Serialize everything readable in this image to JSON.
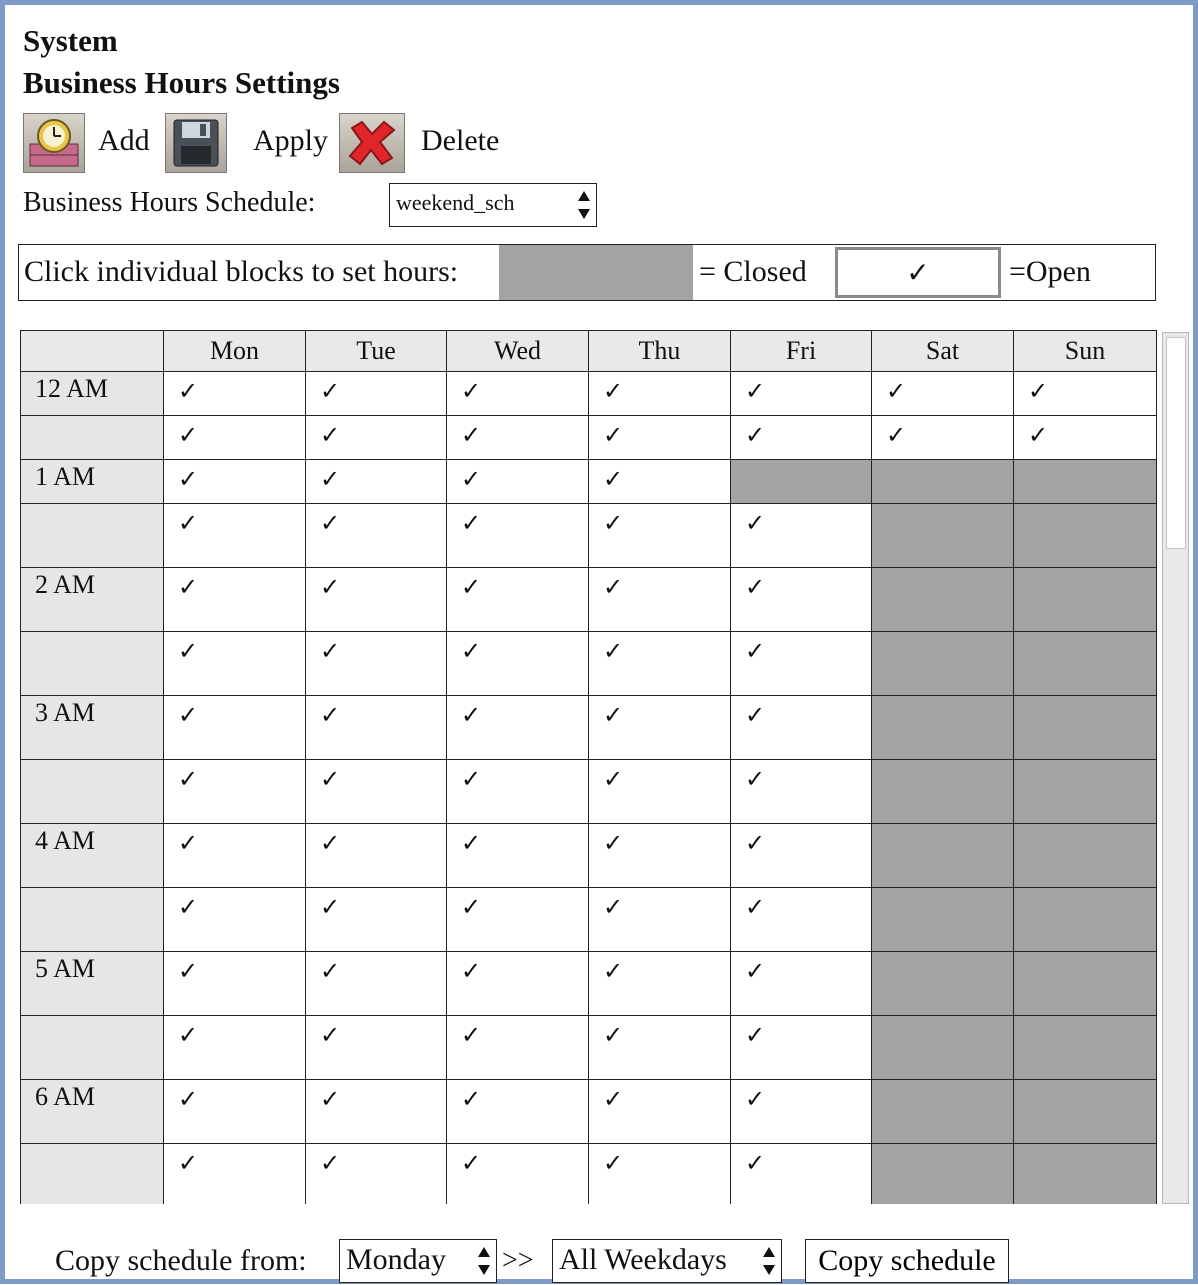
{
  "breadcrumb": "System",
  "page_title": "Business Hours Settings",
  "toolbar": {
    "add_label": "Add",
    "apply_label": "Apply",
    "delete_label": "Delete"
  },
  "schedule": {
    "label": "Business Hours Schedule:",
    "selected": "weekend_sch"
  },
  "legend": {
    "instruction": "Click individual blocks to set hours:",
    "closed_text": "= Closed",
    "open_mark": "✓",
    "open_text": "=Open"
  },
  "grid": {
    "check_mark": "✓",
    "days": [
      "Mon",
      "Tue",
      "Wed",
      "Thu",
      "Fri",
      "Sat",
      "Sun"
    ],
    "rows": [
      {
        "time": "12 AM",
        "open": [
          true,
          true,
          true,
          true,
          true,
          true,
          true
        ]
      },
      {
        "time": "",
        "open": [
          true,
          true,
          true,
          true,
          true,
          true,
          true
        ]
      },
      {
        "time": "1 AM",
        "open": [
          true,
          true,
          true,
          true,
          false,
          false,
          false
        ]
      },
      {
        "time": "",
        "open": [
          true,
          true,
          true,
          true,
          true,
          false,
          false
        ]
      },
      {
        "time": "2 AM",
        "open": [
          true,
          true,
          true,
          true,
          true,
          false,
          false
        ]
      },
      {
        "time": "",
        "open": [
          true,
          true,
          true,
          true,
          true,
          false,
          false
        ]
      },
      {
        "time": "3 AM",
        "open": [
          true,
          true,
          true,
          true,
          true,
          false,
          false
        ]
      },
      {
        "time": "",
        "open": [
          true,
          true,
          true,
          true,
          true,
          false,
          false
        ]
      },
      {
        "time": "4 AM",
        "open": [
          true,
          true,
          true,
          true,
          true,
          false,
          false
        ]
      },
      {
        "time": "",
        "open": [
          true,
          true,
          true,
          true,
          true,
          false,
          false
        ]
      },
      {
        "time": "5 AM",
        "open": [
          true,
          true,
          true,
          true,
          true,
          false,
          false
        ]
      },
      {
        "time": "",
        "open": [
          true,
          true,
          true,
          true,
          true,
          false,
          false
        ]
      },
      {
        "time": "6 AM",
        "open": [
          true,
          true,
          true,
          true,
          true,
          false,
          false
        ]
      },
      {
        "time": "",
        "open": [
          true,
          true,
          true,
          true,
          true,
          false,
          false
        ]
      }
    ]
  },
  "copy": {
    "label": "Copy schedule from:",
    "from_selected": "Monday",
    "arrows": ">>",
    "to_selected": "All Weekdays",
    "button_label": "Copy schedule"
  },
  "colors": {
    "frame_border": "#7d9bc6",
    "closed_fill": "#a3a3a3",
    "header_fill": "#e9e9e9"
  }
}
